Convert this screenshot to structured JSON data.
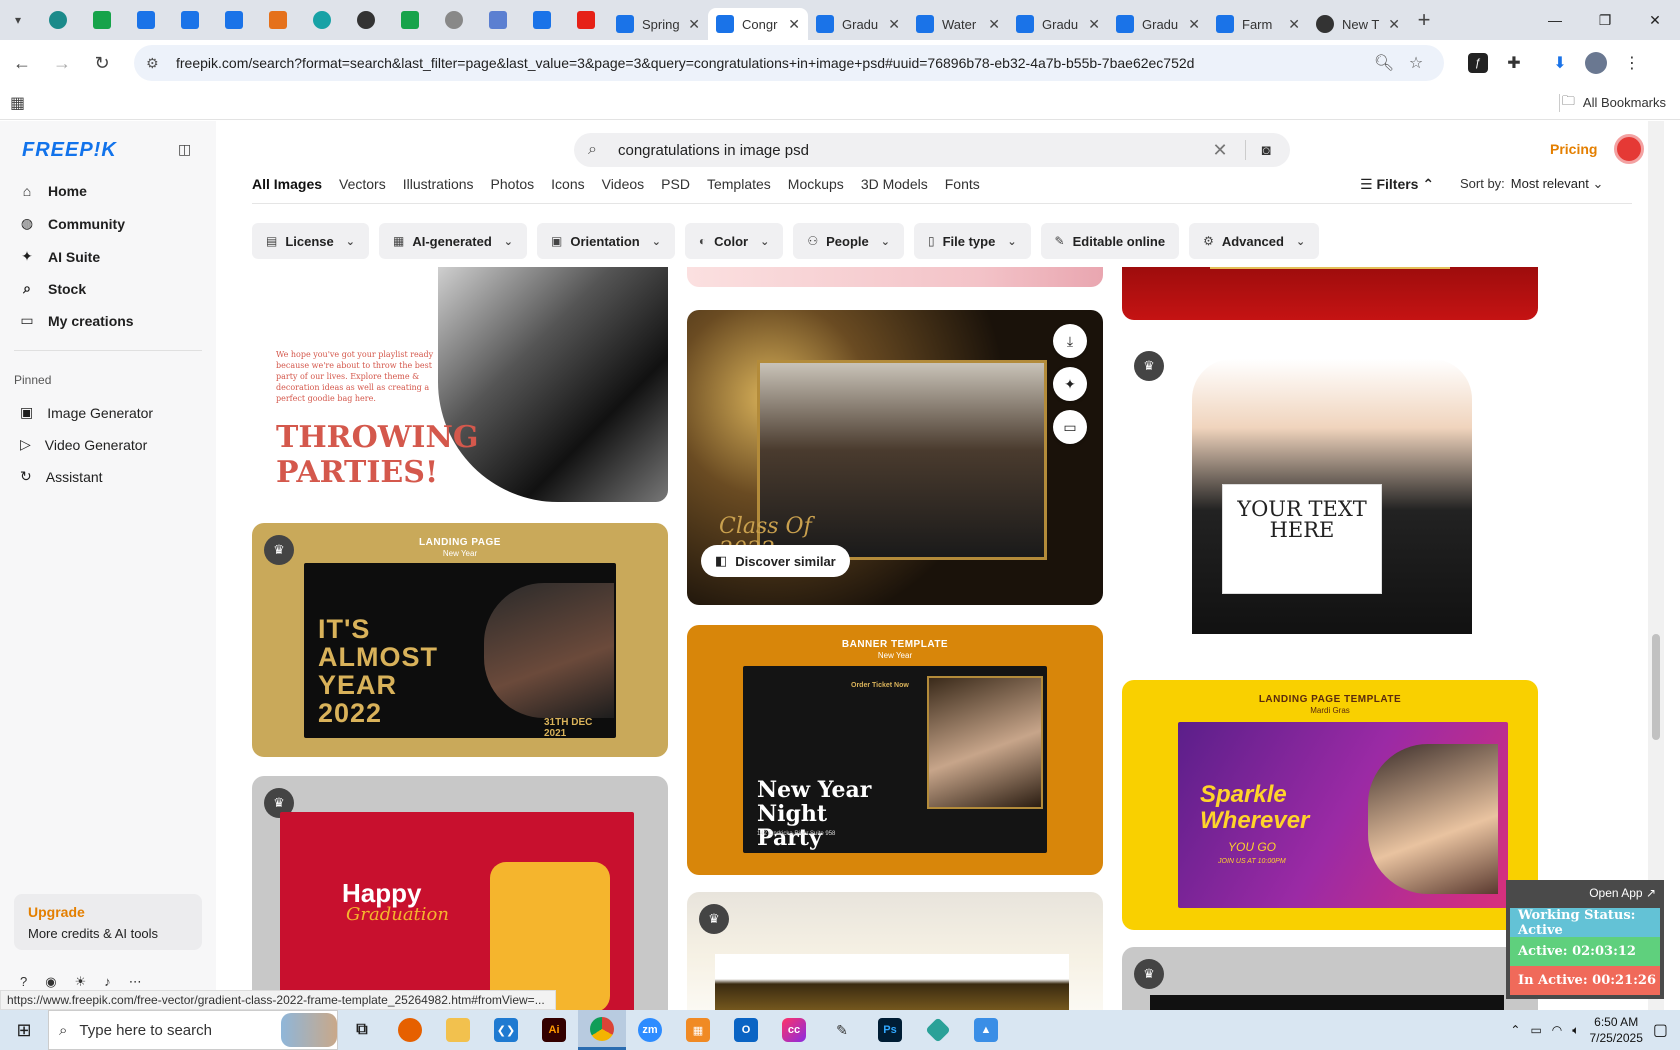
{
  "browser": {
    "tabs": [
      {
        "title": "Spring",
        "color": "#1a73e8"
      },
      {
        "title": "Congr",
        "color": "#1a73e8",
        "active": true
      },
      {
        "title": "Gradu",
        "color": "#1a73e8"
      },
      {
        "title": "Water",
        "color": "#1a73e8"
      },
      {
        "title": "Gradu",
        "color": "#1a73e8"
      },
      {
        "title": "Gradu",
        "color": "#1a73e8"
      },
      {
        "title": "Farm",
        "color": "#1a73e8"
      },
      {
        "title": "New T",
        "color": "#555555"
      }
    ],
    "url": "freepik.com/search?format=search&last_filter=page&last_value=3&page=3&query=congratulations+in+image+psd#uuid=76896b78-eb32-4a7b-b55b-7bae62ec752d",
    "all_bookmarks": "All Bookmarks"
  },
  "sidebar": {
    "logo": "FREEP!K",
    "nav": [
      {
        "label": "Home",
        "icon": "home-icon"
      },
      {
        "label": "Community",
        "icon": "globe-icon"
      },
      {
        "label": "AI Suite",
        "icon": "sparkle-icon"
      },
      {
        "label": "Stock",
        "icon": "search-icon"
      },
      {
        "label": "My creations",
        "icon": "folder-icon"
      }
    ],
    "pinned_label": "Pinned",
    "pinned": [
      {
        "label": "Image Generator",
        "icon": "image-icon"
      },
      {
        "label": "Video Generator",
        "icon": "video-icon"
      },
      {
        "label": "Assistant",
        "icon": "assistant-icon"
      }
    ],
    "upgrade_title": "Upgrade",
    "upgrade_sub": "More credits & AI tools"
  },
  "search": {
    "value": "congratulations in image psd"
  },
  "header": {
    "pricing": "Pricing"
  },
  "categories": [
    "All Images",
    "Vectors",
    "Illustrations",
    "Photos",
    "Icons",
    "Videos",
    "PSD",
    "Templates",
    "Mockups",
    "3D Models",
    "Fonts"
  ],
  "filters_label": "Filters",
  "sort": {
    "label": "Sort by:",
    "value": "Most relevant"
  },
  "chips": [
    "License",
    "AI-generated",
    "Orientation",
    "Color",
    "People",
    "File type",
    "Editable online",
    "Advanced"
  ],
  "cards": {
    "party": {
      "note": "We hope you've got your playlist ready because we're about to throw the best party of our lives. Explore theme & decoration ideas as well as creating a perfect goodie bag here.",
      "headline": "THROWING PARTIES!"
    },
    "landing": {
      "label": "LANDING PAGE",
      "sub": "New Year",
      "headline": "IT'S ALMOST YEAR 2022",
      "date": "31TH DEC 2021"
    },
    "graduation": {
      "discover": "Discover similar",
      "class": "Class Of 2022"
    },
    "banner": {
      "label": "BANNER TEMPLATE",
      "sub": "New Year",
      "headline": "New Year Night Party",
      "address": "142 Ondricka River Suite 958",
      "order": "Order Ticket Now"
    },
    "sign": {
      "text": "YOUR TEXT HERE"
    },
    "mardi": {
      "label": "LANDING PAGE TEMPLATE",
      "sub": "Mardi Gras",
      "headline": "Sparkle Wherever",
      "tag": "YOU GO",
      "cta": "JOIN US AT 10:00PM"
    },
    "happy": {
      "headline": "Happy",
      "script": "Graduation"
    }
  },
  "status_link": "https://www.freepik.com/free-vector/gradient-class-2022-frame-template_25264982.htm#fromView=...",
  "tracker": {
    "open_app": "Open App",
    "working": "Working Status: Active",
    "active": "Active: 02:03:12",
    "inactive": "In Active: 00:21:26"
  },
  "taskbar": {
    "search_placeholder": "Type here to search",
    "time": "6:50 AM",
    "date": "7/25/2025"
  }
}
